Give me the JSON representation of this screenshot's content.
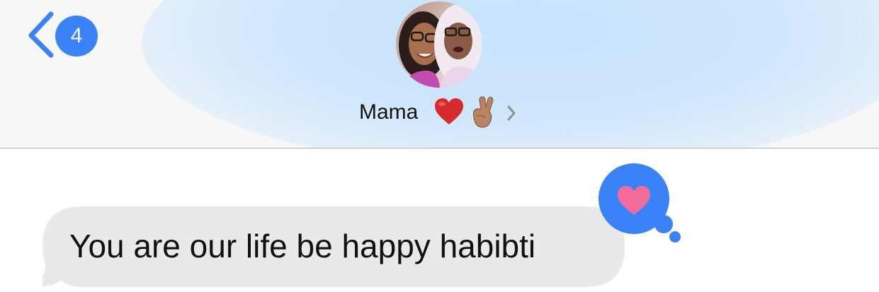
{
  "nav": {
    "unread_count": "4"
  },
  "contact": {
    "name": "Mama",
    "emoji_heart": "❤️",
    "emoji_fingers": "🤞🏽"
  },
  "messages": [
    {
      "text": "You are our life be happy habibti",
      "direction": "incoming",
      "tapback": "heart"
    }
  ],
  "colors": {
    "accent": "#3a82f7",
    "incoming_bubble": "#e9e9eb",
    "tapback_heart": "#f26b9a",
    "header_glow": "#c6e2fd"
  }
}
